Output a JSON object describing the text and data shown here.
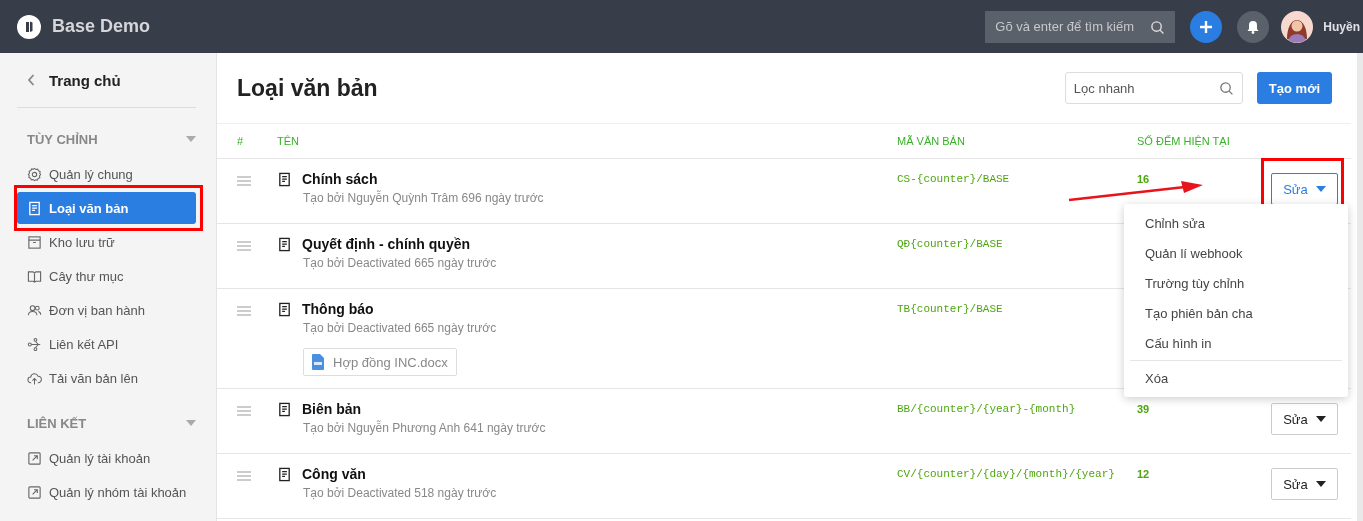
{
  "app": {
    "title": "Base Demo",
    "search": {
      "placeholder": "Gõ và enter để tìm kiếm"
    },
    "user": {
      "name": "Huyền"
    }
  },
  "sidebar": {
    "back": "Trang chủ",
    "sections": [
      {
        "title": "TÙY CHỈNH",
        "expanded": true,
        "items": [
          {
            "label": "Quản lý chung",
            "kind": "gear",
            "selected": false
          },
          {
            "label": "Loại văn bản",
            "kind": "doc",
            "selected": true
          },
          {
            "label": "Kho lưu trữ",
            "kind": "archive",
            "selected": false
          },
          {
            "label": "Cây thư mục",
            "kind": "book",
            "selected": false
          },
          {
            "label": "Đơn vị ban hành",
            "kind": "users",
            "selected": false
          },
          {
            "label": "Liên kết API",
            "kind": "api",
            "selected": false
          },
          {
            "label": "Tải văn bản lên",
            "kind": "upload",
            "selected": false
          }
        ]
      },
      {
        "title": "LIÊN KẾT",
        "expanded": true,
        "items": [
          {
            "label": "Quản lý tài khoản",
            "kind": "external",
            "selected": false
          },
          {
            "label": "Quản lý nhóm tài khoản",
            "kind": "external",
            "selected": false
          }
        ]
      }
    ]
  },
  "page": {
    "title": "Loại văn bản",
    "filter": {
      "placeholder": "Lọc nhanh"
    },
    "create_button": "Tạo mới"
  },
  "table": {
    "columns": [
      "#",
      "TÊN",
      "MÃ VĂN BẢN",
      "SỐ ĐẾM HIỆN TẠI"
    ],
    "rows": [
      {
        "name": "Chính sách",
        "meta": "Tạo bởi Nguyễn Quỳnh Trâm 696 ngày trước",
        "code": "CS-{counter}/BASE",
        "count": "16",
        "action": "Sửa",
        "action_active": true
      },
      {
        "name": "Quyết định - chính quyền",
        "meta": "Tạo bởi Deactivated 665 ngày trước",
        "code": "QĐ{counter}/BASE"
      },
      {
        "name": "Thông báo",
        "meta": "Tạo bởi Deactivated 665 ngày trước",
        "code": "TB{counter}/BASE",
        "attachment": "Hợp đồng INC.docx"
      },
      {
        "name": "Biên bản",
        "meta": "Tạo bởi Nguyễn Phương Anh 641 ngày trước",
        "code": "BB/{counter}/{year}-{month}",
        "count": "39",
        "action": "Sửa",
        "action_active": false
      },
      {
        "name": "Công văn",
        "meta": "Tạo bởi Deactivated 518 ngày trước",
        "code": "CV/{counter}/{day}/{month}/{year}",
        "count": "12",
        "action": "Sửa",
        "action_active": false
      }
    ]
  },
  "dropdown_menu": {
    "items": [
      "Chỉnh sửa",
      "Quản lí webhook",
      "Trường tùy chỉnh",
      "Tạo phiên bản cha",
      "Cấu hình in"
    ],
    "danger_items": [
      "Xóa"
    ]
  }
}
